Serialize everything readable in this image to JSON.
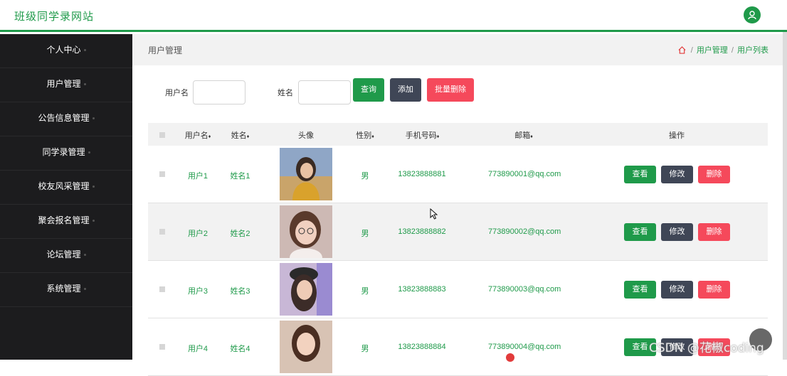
{
  "site": {
    "title": "班级同学录网站"
  },
  "sidebar": {
    "items": [
      {
        "label": "个人中心"
      },
      {
        "label": "用户管理"
      },
      {
        "label": "公告信息管理"
      },
      {
        "label": "同学录管理"
      },
      {
        "label": "校友风采管理"
      },
      {
        "label": "聚会报名管理"
      },
      {
        "label": "论坛管理"
      },
      {
        "label": "系统管理"
      }
    ]
  },
  "breadcrumb": {
    "title": "用户管理",
    "path": [
      "用户管理",
      "用户列表"
    ],
    "sep": "/"
  },
  "search": {
    "username_label": "用户名",
    "username_value": "",
    "name_label": "姓名",
    "name_value": "",
    "query_label": "查询",
    "add_label": "添加",
    "batch_delete_label": "批量删除"
  },
  "table": {
    "headers": [
      "用户名",
      "姓名",
      "头像",
      "性别",
      "手机号码",
      "邮箱",
      "操作"
    ],
    "sort_icon": "♦",
    "rows": [
      {
        "username": "用户1",
        "name": "姓名1",
        "gender": "男",
        "phone": "13823888881",
        "email": "773890001@qq.com"
      },
      {
        "username": "用户2",
        "name": "姓名2",
        "gender": "男",
        "phone": "13823888882",
        "email": "773890002@qq.com"
      },
      {
        "username": "用户3",
        "name": "姓名3",
        "gender": "男",
        "phone": "13823888883",
        "email": "773890003@qq.com"
      },
      {
        "username": "用户4",
        "name": "姓名4",
        "gender": "男",
        "phone": "13823888884",
        "email": "773890004@qq.com"
      }
    ],
    "actions": {
      "view": "查看",
      "edit": "修改",
      "delete": "删除"
    }
  },
  "watermark": "CSDN @花椒coding",
  "colors": {
    "accent": "#1f9a4a",
    "sidebar": "#1c1c1e",
    "edit": "#3f4656",
    "delete": "#f5495b",
    "batch_delete": "#f5495b"
  },
  "icons": {
    "avatar": "user-avatar-icon",
    "home": "home-icon",
    "scroll_top": "scroll-top-icon"
  }
}
